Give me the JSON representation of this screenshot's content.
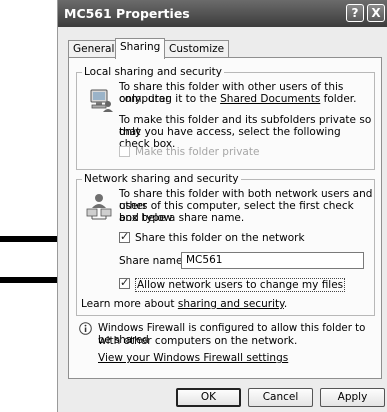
{
  "window": {
    "title": "MC561 Properties",
    "help_label": "?",
    "close_label": "X"
  },
  "tabs": [
    {
      "label": "General",
      "active": false
    },
    {
      "label": "Sharing",
      "active": true
    },
    {
      "label": "Customize",
      "active": false
    }
  ],
  "local_sharing": {
    "group_label": "Local sharing and security",
    "share_text_1": "To share this folder with other users of this computer",
    "share_text_2_prefix": "only, drag it to the ",
    "share_link": "Shared Documents",
    "share_text_2_suffix": " folder.",
    "private_text_1": "To make this folder and its subfolders private so that",
    "private_text_2": "only you have access, select the following check box.",
    "private_checkbox": {
      "label": "Make this folder private",
      "checked": false,
      "enabled": false
    }
  },
  "network_sharing": {
    "group_label": "Network sharing and security",
    "text_1": "To share this folder with both network users and other",
    "text_2": "users of this computer, select the first check box below",
    "text_3": "and type a share name.",
    "share_checkbox": {
      "label": "Share this folder on the network",
      "checked": true
    },
    "share_name_label": "Share name:",
    "share_name_value": "MC561",
    "allow_checkbox": {
      "label": "Allow network users to change my files",
      "checked": true
    },
    "learn_more_prefix": "Learn more about ",
    "learn_more_link": "sharing and security",
    "learn_more_suffix": "."
  },
  "firewall": {
    "text_1": "Windows Firewall is configured to allow this folder to be shared",
    "text_2": "with other computers on the network.",
    "link": "View your Windows Firewall settings"
  },
  "buttons": {
    "ok": "OK",
    "cancel": "Cancel",
    "apply": "Apply"
  },
  "colors": {
    "titlebar": "#4a4a4a",
    "dialog_bg": "#ececec",
    "panel_bg": "#fbfbfb"
  }
}
